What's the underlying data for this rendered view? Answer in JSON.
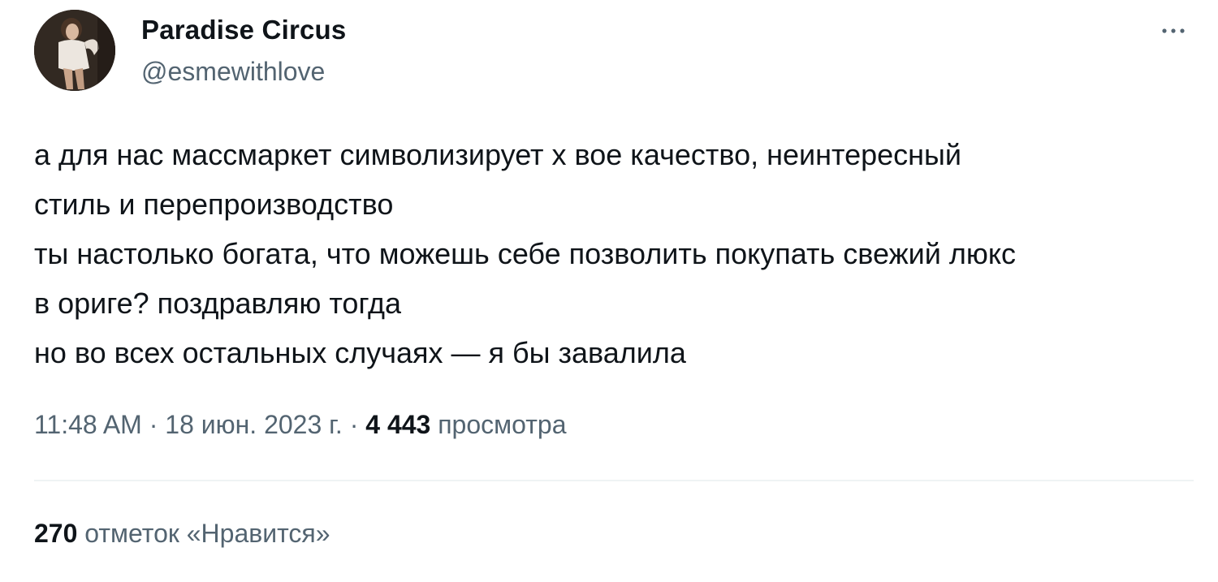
{
  "user": {
    "display_name": "Paradise Circus",
    "handle": "@esmewithlove"
  },
  "tweet": {
    "lines": [
      "а для нас массмаркет символизирует х     вое качество, неинтересный",
      "стиль и перепроизводство",
      "ты настолько богата, что можешь себе позволить покупать свежий люкс",
      "в ориге? поздравляю тогда",
      "но во всех остальных случаях — я бы завалила"
    ]
  },
  "meta": {
    "time": "11:48 AM",
    "separator": "·",
    "date": "18 июн. 2023 г.",
    "views_count": "4 443",
    "views_label": "просмотра"
  },
  "likes": {
    "count": "270",
    "label": "отметок «Нравится»"
  },
  "icons": {
    "more": "more-horizontal-icon",
    "avatar": "profile-photo"
  },
  "colors": {
    "primary_text": "#0f1419",
    "secondary_text": "#536471",
    "divider": "#eff3f4"
  }
}
